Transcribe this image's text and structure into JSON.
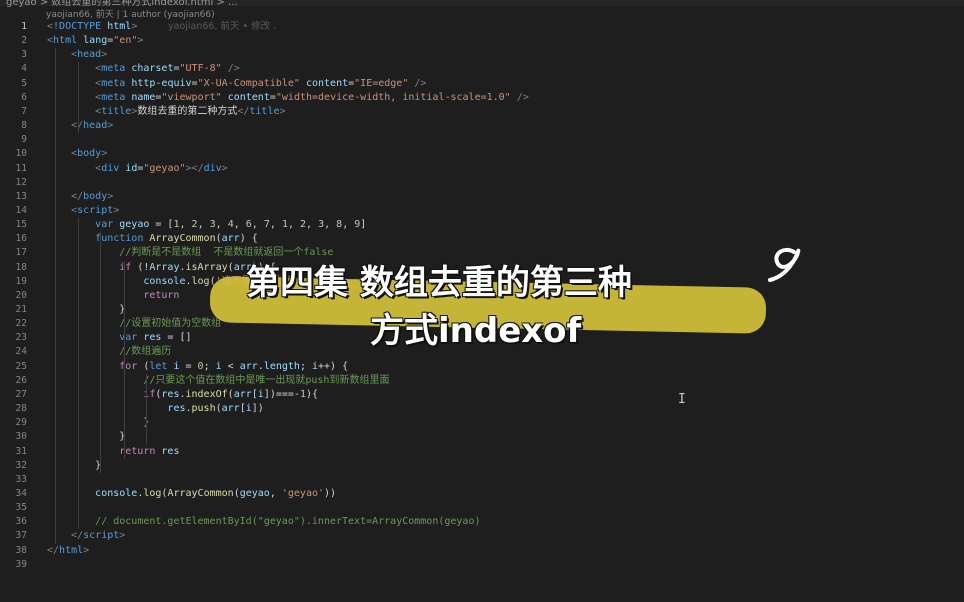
{
  "topbar": {
    "breadcrumb": "geyao > 数组去重的第三种方式indexof.html > ..."
  },
  "blame_header": "yaojian66, 前天 | 1 author (yaojian66)",
  "inline_blame": "yaojian66, 前天 • 修改 .",
  "lines": [
    {
      "n": "1",
      "h": "<span class='p'>&lt;</span><span class='t'>!DOCTYPE</span> <span class='a'>html</span><span class='p'>&gt;</span>"
    },
    {
      "n": "2",
      "h": "<span class='p'>&lt;</span><span class='t'>html</span> <span class='a'>lang</span>=<span class='s'>\"en\"</span><span class='p'>&gt;</span>"
    },
    {
      "n": "3",
      "h": "    <span class='p'>&lt;</span><span class='t'>head</span><span class='p'>&gt;</span>"
    },
    {
      "n": "4",
      "h": "        <span class='p'>&lt;</span><span class='t'>meta</span> <span class='a'>charset</span>=<span class='s'>\"UTF-8\"</span> <span class='p'>/&gt;</span>"
    },
    {
      "n": "5",
      "h": "        <span class='p'>&lt;</span><span class='t'>meta</span> <span class='a'>http-equiv</span>=<span class='s'>\"X-UA-Compatible\"</span> <span class='a'>content</span>=<span class='s'>\"IE=edge\"</span> <span class='p'>/&gt;</span>"
    },
    {
      "n": "6",
      "h": "        <span class='p'>&lt;</span><span class='t'>meta</span> <span class='a'>name</span>=<span class='s'>\"viewport\"</span> <span class='a'>content</span>=<span class='s'>\"width=device-width, initial-scale=1.0\"</span> <span class='p'>/&gt;</span>"
    },
    {
      "n": "7",
      "h": "        <span class='p'>&lt;</span><span class='t'>title</span><span class='p'>&gt;</span>数组去重的第二种方式<span class='p'>&lt;/</span><span class='t'>title</span><span class='p'>&gt;</span>"
    },
    {
      "n": "8",
      "h": "    <span class='p'>&lt;/</span><span class='t'>head</span><span class='p'>&gt;</span>"
    },
    {
      "n": "9",
      "h": ""
    },
    {
      "n": "10",
      "h": "    <span class='p'>&lt;</span><span class='t'>body</span><span class='p'>&gt;</span>"
    },
    {
      "n": "11",
      "h": "        <span class='p'>&lt;</span><span class='t'>div</span> <span class='a'>id</span>=<span class='s'>\"geyao\"</span><span class='p'>&gt;&lt;/</span><span class='t'>div</span><span class='p'>&gt;</span>"
    },
    {
      "n": "12",
      "h": ""
    },
    {
      "n": "13",
      "h": "    <span class='p'>&lt;/</span><span class='t'>body</span><span class='p'>&gt;</span>"
    },
    {
      "n": "14",
      "h": "    <span class='p'>&lt;</span><span class='t'>script</span><span class='p'>&gt;</span>"
    },
    {
      "n": "15",
      "h": "        <span class='kw'>var</span> <span class='a'>geyao</span> = [<span class='n'>1</span>, <span class='n'>2</span>, <span class='n'>3</span>, <span class='n'>4</span>, <span class='n'>6</span>, <span class='n'>7</span>, <span class='n'>1</span>, <span class='n'>2</span>, <span class='n'>3</span>, <span class='n'>8</span>, <span class='n'>9</span>]"
    },
    {
      "n": "16",
      "h": "        <span class='kw'>function</span> <span class='f'>ArrayCommon</span>(<span class='a'>arr</span>) {"
    },
    {
      "n": "17",
      "h": "            <span class='c'>//判断是不是数组  不是数组就返回一个false</span>"
    },
    {
      "n": "18",
      "h": "            <span class='k'>if</span> (!<span class='a'>Array</span>.<span class='f'>isArray</span>(<span class='a'>arr</span>)) {"
    },
    {
      "n": "19",
      "h": "                <span class='a'>console</span>.<span class='f'>log</span>(<span class='s'>'这不是一个数组'</span>)"
    },
    {
      "n": "20",
      "h": "                <span class='k'>return</span>"
    },
    {
      "n": "21",
      "h": "            }"
    },
    {
      "n": "22",
      "h": "            <span class='c'>//设置初始值为空数组</span>"
    },
    {
      "n": "23",
      "h": "            <span class='kw'>var</span> <span class='a'>res</span> = []"
    },
    {
      "n": "24",
      "h": "            <span class='c'>//数组遍历</span>"
    },
    {
      "n": "25",
      "h": "            <span class='k'>for</span> (<span class='kw'>let</span> <span class='a'>i</span> = <span class='n'>0</span>; <span class='a'>i</span> &lt; <span class='a'>arr</span>.<span class='a'>length</span>; <span class='a'>i</span>++) {"
    },
    {
      "n": "26",
      "h": "                <span class='c'>//只要这个值在数组中是唯一出现就push到新数组里面</span>"
    },
    {
      "n": "27",
      "h": "                <span class='k'>if</span>(<span class='a'>res</span>.<span class='f'>indexOf</span>(<span class='a'>arr</span>[<span class='a'>i</span>])===-<span class='n'>1</span>){"
    },
    {
      "n": "28",
      "h": "                    <span class='a'>res</span>.<span class='f'>push</span>(<span class='a'>arr</span>[<span class='a'>i</span>])"
    },
    {
      "n": "29",
      "h": "                }"
    },
    {
      "n": "30",
      "h": "            }"
    },
    {
      "n": "31",
      "h": "            <span class='k'>return</span> <span class='a'>res</span>"
    },
    {
      "n": "32",
      "h": "        }"
    },
    {
      "n": "33",
      "h": ""
    },
    {
      "n": "34",
      "h": "        <span class='a'>console</span>.<span class='f'>log</span>(<span class='f'>ArrayCommon</span>(<span class='a'>geyao</span>, <span class='s'>'geyao'</span>))"
    },
    {
      "n": "35",
      "h": ""
    },
    {
      "n": "36",
      "h": "        <span class='c'>// document.getElementById(\"geyao\").innerText=ArrayCommon(geyao)</span>"
    },
    {
      "n": "37",
      "h": "    <span class='p'>&lt;/</span><span class='t'>script</span><span class='p'>&gt;</span>"
    },
    {
      "n": "38",
      "h": "<span class='p'>&lt;/</span><span class='t'>html</span><span class='p'>&gt;</span>"
    },
    {
      "n": "39",
      "h": ""
    }
  ],
  "overlay": {
    "title_line1": "第四集 数组去重的第三种",
    "title_line2": "方式indexof"
  },
  "icons": {
    "text_cursor": "I"
  },
  "colors": {
    "banner": "#d4c23a",
    "editor_bg": "#1e1e1e"
  }
}
